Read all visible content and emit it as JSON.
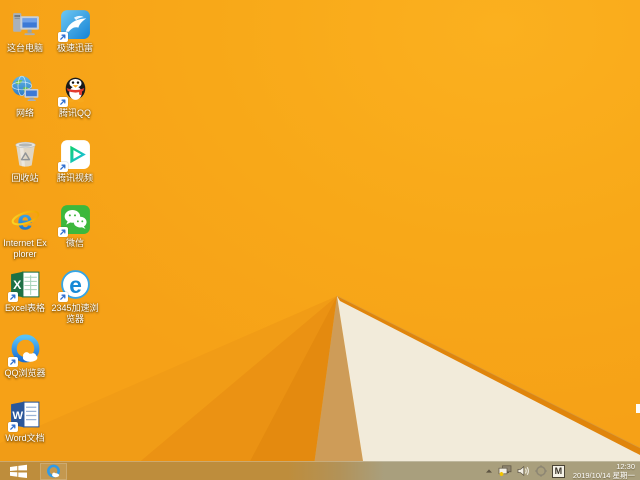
{
  "wallpaper": {
    "base_color": "#F8A818",
    "cream_color": "#F2EBDA",
    "ridge_color": "#E0850C",
    "tan_color": "#CE9C58",
    "facet_colors": [
      "#F19C16",
      "#EB9213",
      "#E48A0F"
    ]
  },
  "desktop": {
    "icons": [
      {
        "label": "这台电脑",
        "name": "this-pc",
        "shortcut": false
      },
      {
        "label": "极速迅雷",
        "name": "xunlei",
        "shortcut": true
      },
      {
        "label": "网络",
        "name": "network",
        "shortcut": false
      },
      {
        "label": "腾讯QQ",
        "name": "tencent-qq",
        "shortcut": true
      },
      {
        "label": "回收站",
        "name": "recycle-bin",
        "shortcut": false
      },
      {
        "label": "腾讯视频",
        "name": "tencent-video",
        "shortcut": true
      },
      {
        "label": "Internet Explorer",
        "name": "internet-explorer",
        "shortcut": false
      },
      {
        "label": "微信",
        "name": "wechat",
        "shortcut": true
      },
      {
        "label": "Excel表格",
        "name": "excel",
        "shortcut": true
      },
      {
        "label": "2345加速浏览器",
        "name": "browser-2345",
        "shortcut": true
      },
      {
        "label": "QQ浏览器",
        "name": "qq-browser",
        "shortcut": true
      },
      {
        "label": "Word文档",
        "name": "word",
        "shortcut": true
      }
    ]
  },
  "taskbar": {
    "start": {
      "label": "开始"
    },
    "pinned": [
      {
        "name": "qq-browser"
      }
    ],
    "tray": {
      "ime_label": "M",
      "clock": {
        "time": "12:30",
        "date": "2019/10/14 星期一"
      }
    }
  }
}
